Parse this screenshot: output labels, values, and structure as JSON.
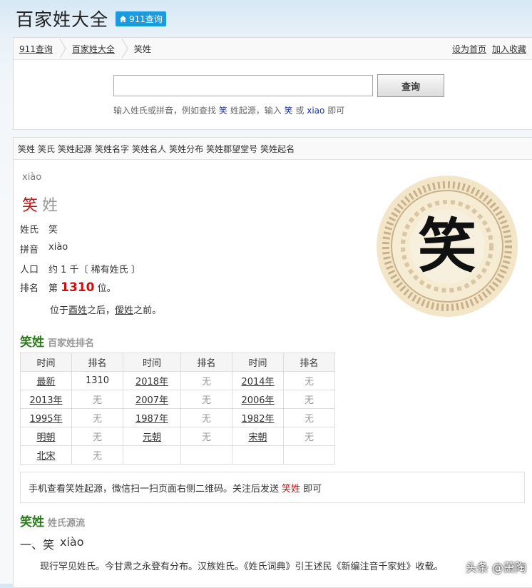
{
  "header": {
    "site_title": "百家姓大全",
    "home_badge": "911查询"
  },
  "breadcrumb": {
    "items": [
      "911查询",
      "百家姓大全",
      "笑姓"
    ]
  },
  "top_links": {
    "set_home": "设为首页",
    "add_fav": "加入收藏"
  },
  "search": {
    "input_value": "",
    "button_label": "查询",
    "hint_pre": "输入姓氏或拼音，例如查找",
    "hint_kw1": "笑",
    "hint_mid": "姓起源，输入",
    "hint_kw2": "笑",
    "hint_or": "或",
    "hint_kw3": "xiao",
    "hint_post": "即可"
  },
  "tags": [
    "笑姓",
    "笑氏",
    "笑姓起源",
    "笑姓名字",
    "笑姓名人",
    "笑姓分布",
    "笑姓郡望堂号",
    "笑姓起名"
  ],
  "surname": {
    "pinyin": "xiào",
    "char": "笑",
    "suffix": "姓",
    "info": {
      "label_surname": "姓氏",
      "value_surname": "笑",
      "label_pinyin": "拼音",
      "value_pinyin": "xiào",
      "label_pop": "人口",
      "value_pop": "约 1 千〔 稀有姓氏 〕",
      "label_rank": "排名",
      "rank_pre": "第",
      "rank_num": "1310",
      "rank_post": "位。",
      "pos_pre": "位于",
      "pos_prev": "酉姓",
      "pos_mid": "之后，",
      "pos_next": "僾姓",
      "pos_post": "之前。"
    },
    "seal_char": "笑"
  },
  "rank_section": {
    "title": "笑姓",
    "sub": "百家姓排名"
  },
  "rank_table": {
    "headers": [
      "时间",
      "排名",
      "时间",
      "排名",
      "时间",
      "排名"
    ],
    "rows": [
      [
        "最新",
        "1310",
        "2018年",
        "无",
        "2014年",
        "无"
      ],
      [
        "2013年",
        "无",
        "2007年",
        "无",
        "2006年",
        "无"
      ],
      [
        "1995年",
        "无",
        "1987年",
        "无",
        "1982年",
        "无"
      ],
      [
        "明朝",
        "无",
        "元朝",
        "无",
        "宋朝",
        "无"
      ],
      [
        "北宋",
        "无",
        "",
        "",
        "",
        ""
      ]
    ]
  },
  "notice": {
    "pre": "手机查看笑姓起源，微信扫一扫页面右侧二维码。关注后发送",
    "kw": "笑姓",
    "post": "即可"
  },
  "origin_section": {
    "title": "笑姓",
    "sub": "姓氏源流"
  },
  "origin": {
    "heading_num": "一、笑",
    "heading_py": "xiào",
    "text": "现行罕见姓氏。今甘肃之永登有分布。汉族姓氏。《姓氏词典》引王述民《新编注音千家姓》收载。"
  },
  "watermark": "头条 @萧陶"
}
